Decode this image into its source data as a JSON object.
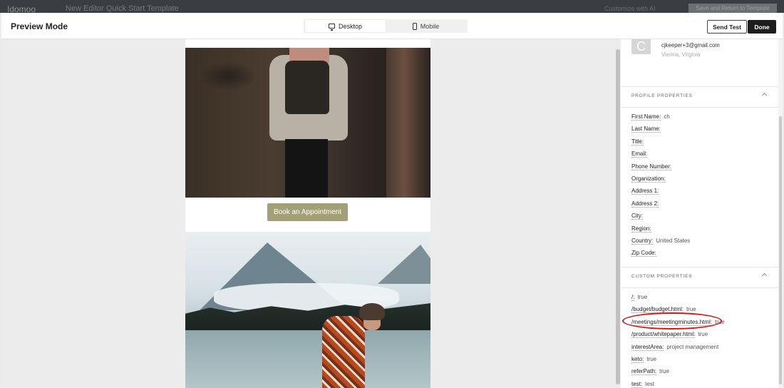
{
  "background_app": {
    "logo": "Idomoo",
    "title": "New Editor Quick Start Template",
    "right_text": "Customize with AI",
    "right_button": "Save and Return to Template"
  },
  "header": {
    "title": "Preview Mode",
    "toggle": {
      "desktop": "Desktop",
      "mobile": "Mobile",
      "selected": "Desktop"
    },
    "send_test": "Send Test",
    "done": "Done"
  },
  "email_preview": {
    "cta_label": "Book an Appointment",
    "cta_color": "#a39f76"
  },
  "contact": {
    "avatar_initial": "C",
    "email": "cjkeeper+3@gmail.com",
    "location": "Vienna, Virginia"
  },
  "profile_properties": {
    "heading": "PROFILE PROPERTIES",
    "items": [
      {
        "key": "First Name:",
        "value": "ch"
      },
      {
        "key": "Last Name:",
        "value": ""
      },
      {
        "key": "Title:",
        "value": ""
      },
      {
        "key": "Email:",
        "value": ""
      },
      {
        "key": "Phone Number:",
        "value": ""
      },
      {
        "key": "Organization:",
        "value": ""
      },
      {
        "key": "Address 1:",
        "value": ""
      },
      {
        "key": "Address 2:",
        "value": ""
      },
      {
        "key": "City:",
        "value": ""
      },
      {
        "key": "Region:",
        "value": ""
      },
      {
        "key": "Country:",
        "value": "United States"
      },
      {
        "key": "Zip Code:",
        "value": ""
      }
    ]
  },
  "custom_properties": {
    "heading": "CUSTOM PROPERTIES",
    "items": [
      {
        "key": "/:",
        "value": "true"
      },
      {
        "key": "/budget/budget.html:",
        "value": "true"
      },
      {
        "key": "/meetings/meetingminutes.html:",
        "value": "true"
      },
      {
        "key": "/product/whitepaper.html:",
        "value": "true"
      },
      {
        "key": "interestArea:",
        "value": "project management"
      },
      {
        "key": "keto:",
        "value": "true"
      },
      {
        "key": "referPath:",
        "value": "true"
      },
      {
        "key": "test:",
        "value": "test"
      }
    ]
  },
  "highlight_color": "#cd1b1b"
}
